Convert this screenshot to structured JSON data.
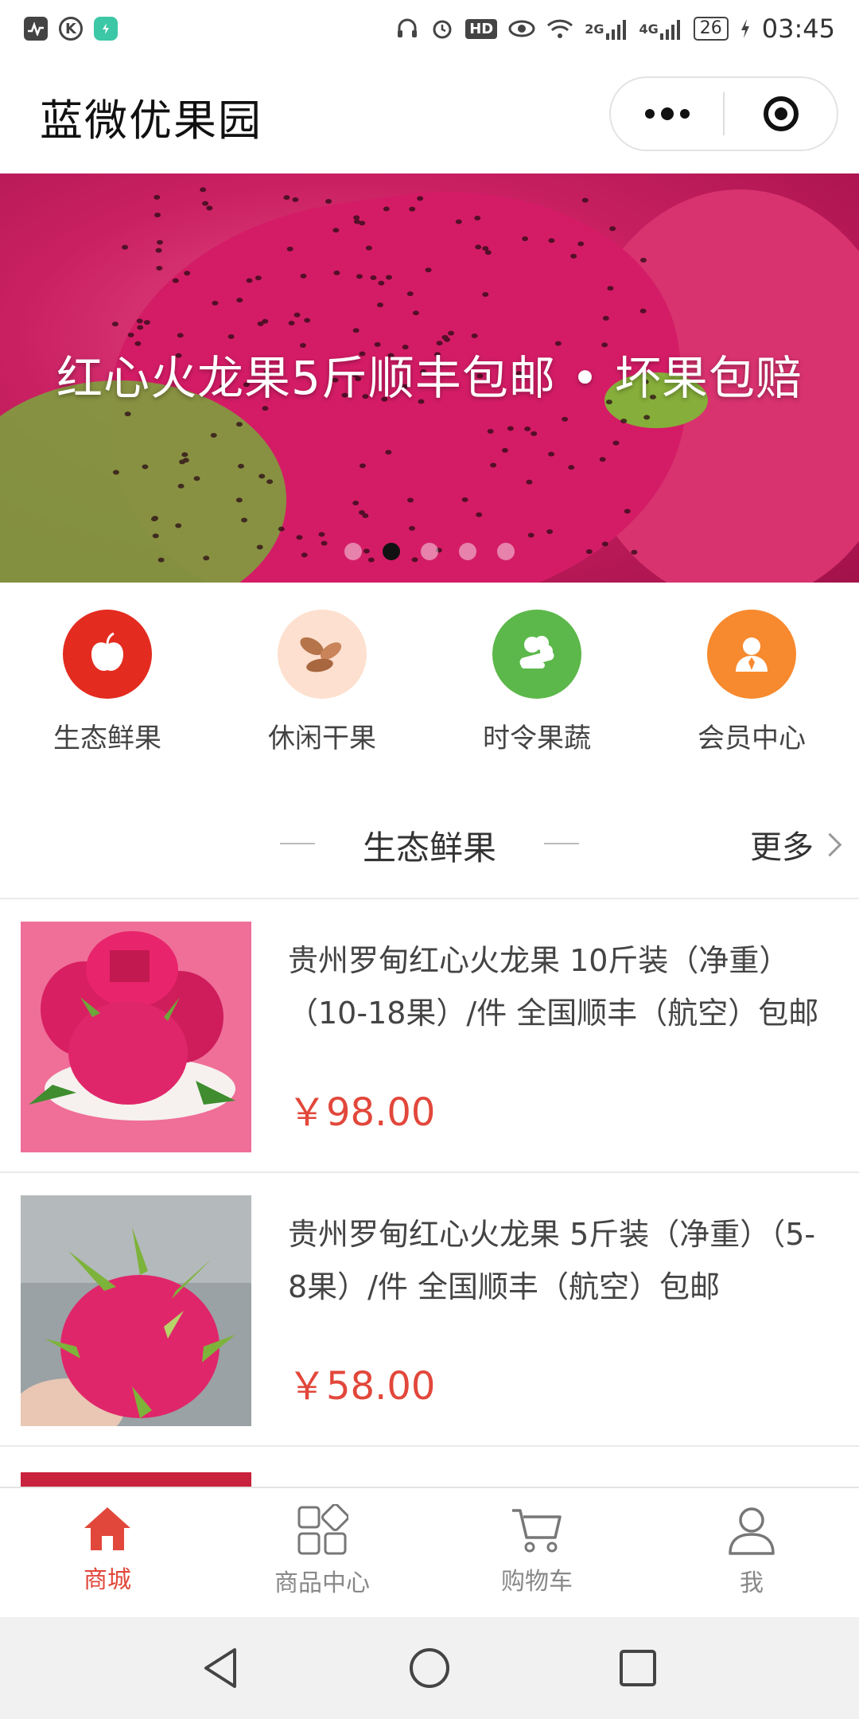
{
  "status_bar": {
    "time": "03:45",
    "battery": "26",
    "network_2g": "2G",
    "network_4g": "4G",
    "hd": "HD",
    "k_icon_letter": "K"
  },
  "nav": {
    "title": "蓝微优果园"
  },
  "banner": {
    "text": "红心火龙果5斤顺丰包邮 • 坏果包赔",
    "slide_count": 5,
    "active_index": 1
  },
  "categories": [
    {
      "label": "生态鲜果",
      "icon": "apple-icon",
      "color": "#e32b1f"
    },
    {
      "label": "休闲干果",
      "icon": "almond-icon",
      "color": "#fde0cf"
    },
    {
      "label": "时令果蔬",
      "icon": "vegetable-icon",
      "color": "#5cb84a"
    },
    {
      "label": "会员中心",
      "icon": "member-icon",
      "color": "#f7892e"
    }
  ],
  "section": {
    "title": "生态鲜果",
    "more": "更多"
  },
  "products": [
    {
      "title": "贵州罗甸红心火龙果 10斤装（净重）（10-18果）/件 全国顺丰（航空）包邮",
      "price": "￥98.00"
    },
    {
      "title": "贵州罗甸红心火龙果 5斤装（净重）（5-8果）/件 全国顺丰（航空）包邮",
      "price": "￥58.00"
    }
  ],
  "tabs": [
    {
      "label": "商城",
      "icon": "home-icon",
      "active": true
    },
    {
      "label": "商品中心",
      "icon": "grid-icon",
      "active": false
    },
    {
      "label": "购物车",
      "icon": "cart-icon",
      "active": false
    },
    {
      "label": "我",
      "icon": "user-icon",
      "active": false
    }
  ],
  "colors": {
    "accent": "#e2473b",
    "tab_inactive": "#888888"
  }
}
